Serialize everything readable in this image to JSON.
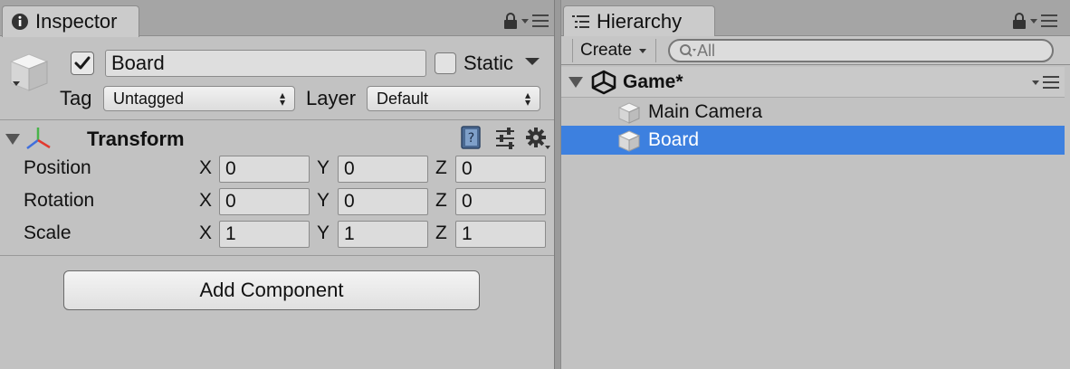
{
  "inspector": {
    "tab_label": "Inspector",
    "object": {
      "name": "Board",
      "active": true,
      "static_label": "Static",
      "static": false,
      "tag_label": "Tag",
      "tag_value": "Untagged",
      "layer_label": "Layer",
      "layer_value": "Default"
    },
    "transform": {
      "title": "Transform",
      "axes": [
        "X",
        "Y",
        "Z"
      ],
      "rows": [
        {
          "label": "Position",
          "values": [
            "0",
            "0",
            "0"
          ]
        },
        {
          "label": "Rotation",
          "values": [
            "0",
            "0",
            "0"
          ]
        },
        {
          "label": "Scale",
          "values": [
            "1",
            "1",
            "1"
          ]
        }
      ]
    },
    "add_component_label": "Add Component"
  },
  "hierarchy": {
    "tab_label": "Hierarchy",
    "create_label": "Create",
    "search_placeholder": "All",
    "scene_name": "Game*",
    "items": [
      {
        "name": "Main Camera",
        "selected": false
      },
      {
        "name": "Board",
        "selected": true
      }
    ]
  },
  "colors": {
    "selection": "#3d80df",
    "panel_bg": "#c2c2c2"
  },
  "icons": [
    "info-icon",
    "lock-icon",
    "panel-menu-icon",
    "cube-icon",
    "checkmark-icon",
    "transform-axes-icon",
    "help-book-icon",
    "preset-icon",
    "settings-gear-icon",
    "hierarchy-list-icon",
    "search-icon",
    "unity-logo-icon",
    "fold-triangle-icon"
  ]
}
